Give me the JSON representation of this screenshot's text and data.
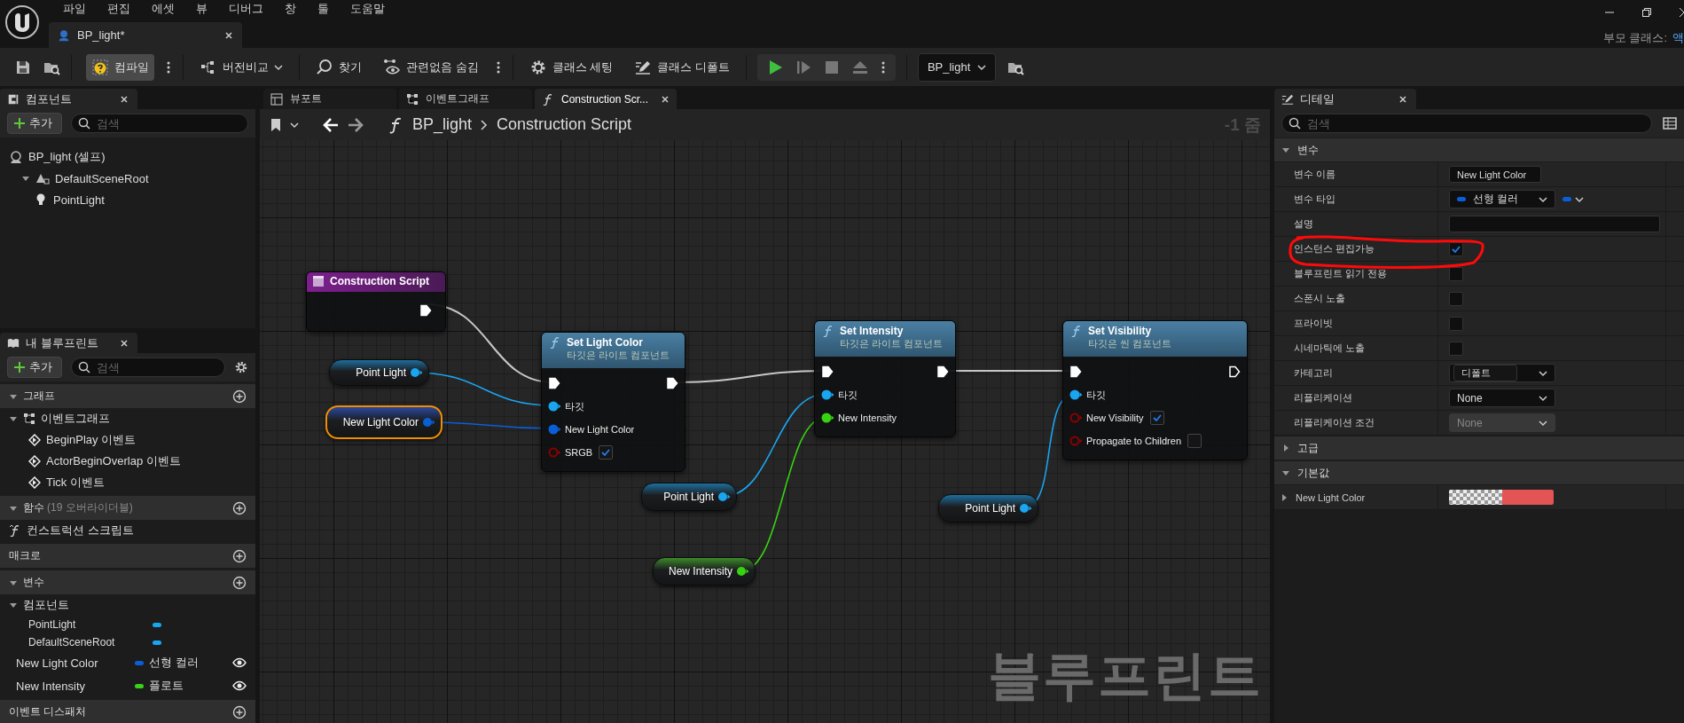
{
  "menu": [
    "파일",
    "편집",
    "에셋",
    "뷰",
    "디버그",
    "창",
    "툴",
    "도움말"
  ],
  "document_tab": {
    "label": "BP_light*"
  },
  "parent_class": {
    "label": "부모 클래스:",
    "value": "액"
  },
  "toolbar": {
    "buttons": [
      {
        "kind": "compile",
        "label": "컴파일"
      },
      {
        "kind": "diff",
        "label": "버전비교"
      },
      {
        "kind": "find",
        "label": "찾기"
      },
      {
        "kind": "hide",
        "label": "관련없음 숨김"
      },
      {
        "kind": "settings",
        "label": "클래스 세팅"
      },
      {
        "kind": "defaults",
        "label": "클래스 디폴트"
      }
    ],
    "debug_object": "BP_light"
  },
  "components_panel": {
    "title": "컴포넌트",
    "add_button": "추가",
    "search_placeholder": "검색",
    "tree": [
      {
        "label": "BP_light (셀프)",
        "kind": "self",
        "children": [
          {
            "label": "DefaultSceneRoot",
            "kind": "scene",
            "expanded": true,
            "children": [
              {
                "label": "PointLight",
                "kind": "light"
              }
            ]
          }
        ]
      }
    ]
  },
  "blueprint_panel": {
    "title": "내 블루프린트",
    "add_button": "추가",
    "search_placeholder": "검색",
    "sections": [
      {
        "label": "그래프",
        "expanded": true,
        "items": [
          {
            "label": "이벤트그래프",
            "kind": "graph",
            "expanded": true,
            "children": [
              {
                "label": "BeginPlay 이벤트",
                "kind": "event"
              },
              {
                "label": "ActorBeginOverlap 이벤트",
                "kind": "event"
              },
              {
                "label": "Tick 이벤트",
                "kind": "event"
              }
            ]
          }
        ]
      },
      {
        "label": "함수",
        "note": "(19 오버라이더블)",
        "expanded": true,
        "items": [
          {
            "label": "컨스트럭션 스크립트",
            "kind": "function"
          }
        ]
      },
      {
        "label": "매크로"
      },
      {
        "label": "변수",
        "expanded": true,
        "items": [
          {
            "label": "컴포넌트",
            "kind": "category",
            "expanded": true,
            "children": [
              {
                "label": "PointLight",
                "kind": "variable",
                "color": "#19a5f0"
              },
              {
                "label": "DefaultSceneRoot",
                "kind": "variable",
                "color": "#19a5f0"
              }
            ]
          },
          {
            "label": "New Light Color",
            "kind": "variable",
            "color": "#0a5fd8",
            "type": "선형 컬러",
            "public": true
          },
          {
            "label": "New Intensity",
            "kind": "variable",
            "color": "#38d21a",
            "type": "플로트",
            "public": true
          }
        ]
      },
      {
        "label": "이벤트 디스패처"
      }
    ]
  },
  "graph": {
    "tabs": [
      {
        "label": "뷰포트",
        "kind": "viewport",
        "selected": false
      },
      {
        "label": "이벤트그래프",
        "kind": "graph",
        "selected": false
      },
      {
        "label": "Construction Scr...",
        "kind": "function",
        "selected": true
      }
    ],
    "breadcrumb": [
      "BP_light",
      "Construction Script"
    ],
    "zoom": "-1 줌",
    "watermark": "블루프린트",
    "nodes": [
      {
        "kind": "event",
        "title": "Construction Script",
        "rows": [
          {
            "kind": "exec",
            "out_connected": true
          }
        ]
      },
      {
        "kind": "variable",
        "label": "Point Light",
        "pin": {
          "kind": "object"
        },
        "selected": false
      },
      {
        "kind": "variable",
        "label": "New Light Color",
        "pin": {
          "kind": "color"
        },
        "selected": true
      },
      {
        "kind": "function",
        "title": "Set Light Color",
        "subtitle": "타깃은 라이트 컴포넌트",
        "rows": [
          {
            "kind": "exec",
            "connected": true,
            "out_connected": true
          },
          {
            "kind": "object",
            "label": "타깃",
            "connected": true
          },
          {
            "kind": "color",
            "label": "New Light Color",
            "connected": true
          },
          {
            "kind": "bool",
            "label": "SRGB",
            "connected": false,
            "checked": true
          }
        ]
      },
      {
        "kind": "variable",
        "label": "Point Light",
        "pin": {
          "kind": "object"
        },
        "selected": false
      },
      {
        "kind": "variable",
        "label": "New Intensity",
        "pin": {
          "kind": "float"
        },
        "selected": false
      },
      {
        "kind": "function",
        "title": "Set Intensity",
        "subtitle": "타깃은 라이트 컴포넌트",
        "rows": [
          {
            "kind": "exec",
            "connected": true,
            "out_connected": true
          },
          {
            "kind": "object",
            "label": "타깃",
            "connected": true
          },
          {
            "kind": "float",
            "label": "New Intensity",
            "connected": true
          }
        ]
      },
      {
        "kind": "variable",
        "label": "Point Light",
        "pin": {
          "kind": "object"
        },
        "selected": false
      },
      {
        "kind": "function",
        "title": "Set Visibility",
        "subtitle": "타깃은 씬 컴포넌트",
        "rows": [
          {
            "kind": "exec",
            "connected": true,
            "out_connected": false
          },
          {
            "kind": "object",
            "label": "타깃",
            "connected": true
          },
          {
            "kind": "bool",
            "label": "New Visibility",
            "connected": false,
            "checked": true
          },
          {
            "kind": "bool",
            "label": "Propagate to Children",
            "connected": false,
            "checked": false
          }
        ]
      }
    ]
  },
  "details_panel": {
    "title": "디테일",
    "search_placeholder": "검색",
    "sections": [
      {
        "label": "변수",
        "expanded": true,
        "rows": [
          {
            "label": "변수 이름",
            "kind": "text",
            "value": "New Light Color"
          },
          {
            "label": "변수 타입",
            "kind": "type",
            "value": "선형 컬러",
            "color": "#0a5fd8"
          },
          {
            "label": "설명",
            "kind": "wide_text"
          },
          {
            "label": "인스턴스 편집가능",
            "kind": "checkbox",
            "checked": true
          },
          {
            "label": "블루프린트 읽기 전용",
            "kind": "checkbox",
            "checked": false
          },
          {
            "label": "스폰시 노출",
            "kind": "checkbox",
            "checked": false
          },
          {
            "label": "프라이빗",
            "kind": "checkbox",
            "checked": false
          },
          {
            "label": "시네마틱에 노출",
            "kind": "checkbox",
            "checked": false
          },
          {
            "label": "카테고리",
            "kind": "combo",
            "value": "디폴트"
          },
          {
            "label": "리플리케이션",
            "kind": "dropdown",
            "value": "None",
            "disabled": false
          },
          {
            "label": "리플리케이션 조건",
            "kind": "dropdown",
            "value": "None",
            "disabled": true
          }
        ]
      },
      {
        "label": "고급",
        "expanded": false
      },
      {
        "label": "기본값",
        "expanded": true,
        "rows": [
          {
            "label": "New Light Color",
            "kind": "color",
            "expanded": false,
            "color": "#e35454"
          }
        ]
      }
    ]
  }
}
